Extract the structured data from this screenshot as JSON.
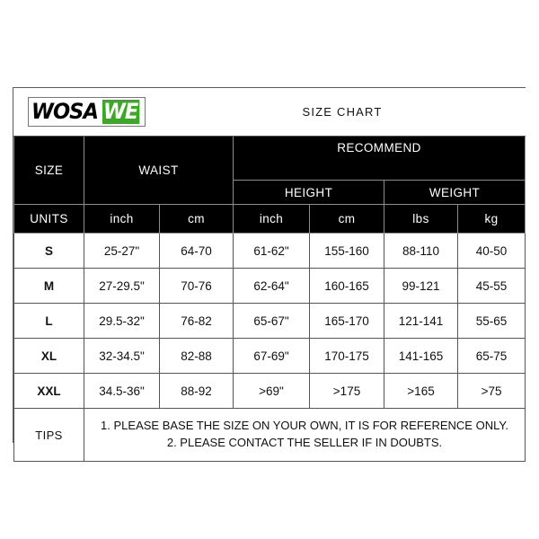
{
  "logo": {
    "part_dark": "WOSA",
    "part_green": "WE",
    "green_color": "#3da828"
  },
  "title": "SIZE CHART",
  "header": {
    "size": "SIZE",
    "waist": "WAIST",
    "recommend": "RECOMMEND",
    "height": "HEIGHT",
    "weight": "WEIGHT",
    "units_label": "UNITS",
    "units": {
      "waist_inch": "inch",
      "waist_cm": "cm",
      "height_inch": "inch",
      "height_cm": "cm",
      "weight_lbs": "lbs",
      "weight_kg": "kg"
    }
  },
  "rows": [
    {
      "size": "S",
      "waist_inch": "25-27\"",
      "waist_cm": "64-70",
      "height_inch": "61-62\"",
      "height_cm": "155-160",
      "weight_lbs": "88-110",
      "weight_kg": "40-50"
    },
    {
      "size": "M",
      "waist_inch": "27-29.5\"",
      "waist_cm": "70-76",
      "height_inch": "62-64\"",
      "height_cm": "160-165",
      "weight_lbs": "99-121",
      "weight_kg": "45-55"
    },
    {
      "size": "L",
      "waist_inch": "29.5-32\"",
      "waist_cm": "76-82",
      "height_inch": "65-67\"",
      "height_cm": "165-170",
      "weight_lbs": "121-141",
      "weight_kg": "55-65"
    },
    {
      "size": "XL",
      "waist_inch": "32-34.5\"",
      "waist_cm": "82-88",
      "height_inch": "67-69\"",
      "height_cm": "170-175",
      "weight_lbs": "141-165",
      "weight_kg": "65-75"
    },
    {
      "size": "XXL",
      "waist_inch": "34.5-36\"",
      "waist_cm": "88-92",
      "height_inch": ">69\"",
      "height_cm": ">175",
      "weight_lbs": ">165",
      "weight_kg": ">75"
    }
  ],
  "tips": {
    "label": "TIPS",
    "line1": "1. PLEASE BASE THE SIZE ON YOUR OWN, IT IS FOR REFERENCE ONLY.",
    "line2": "2. PLEASE CONTACT THE SELLER IF IN DOUBTS."
  }
}
